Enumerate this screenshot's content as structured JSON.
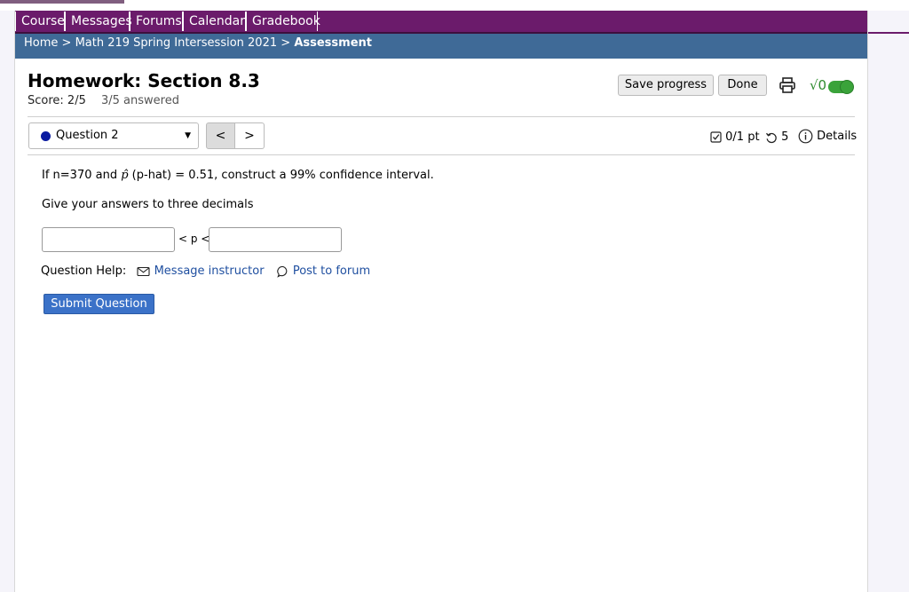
{
  "nav": {
    "items": [
      "Course",
      "Messages",
      "Forums",
      "Calendar",
      "Gradebook"
    ]
  },
  "breadcrumb": {
    "home": "Home",
    "sep1": ">",
    "course": "Math 219 Spring Intersession 2021",
    "sep2": ">",
    "current": "Assessment"
  },
  "assessment": {
    "title": "Homework: Section 8.3",
    "score": "Score: 2/5",
    "answered": "3/5 answered",
    "save_label": "Save progress",
    "done_label": "Done",
    "sqrt_label": "√0"
  },
  "question_nav": {
    "selected": "Question 2",
    "prev_label": "<",
    "next_label": ">",
    "points": "0/1 pt",
    "attempts": "5",
    "details_label": "Details"
  },
  "question": {
    "part1": "If n=370 and ",
    "phat": "p̂",
    "part2": " (p-hat) = 0.51, construct a 99% confidence interval.",
    "instruction": "Give your answers to three decimals",
    "lower_value": "",
    "upper_value": "",
    "between": "< p <"
  },
  "help": {
    "label": "Question Help:",
    "message_label": "Message instructor",
    "forum_label": "Post to forum"
  },
  "submit_label": "Submit Question",
  "colors": {
    "nav_bg": "#6b1b6b",
    "breadcrumb_bg": "#3f6a97",
    "submit_bg": "#3b72c8",
    "toggle_green": "#3aa33a",
    "link": "#1f4fa0"
  },
  "icons": [
    "print-icon",
    "toggle-icon",
    "checkbox-icon",
    "retry-icon",
    "info-icon",
    "mail-icon",
    "chat-icon",
    "chevron-down-icon"
  ]
}
